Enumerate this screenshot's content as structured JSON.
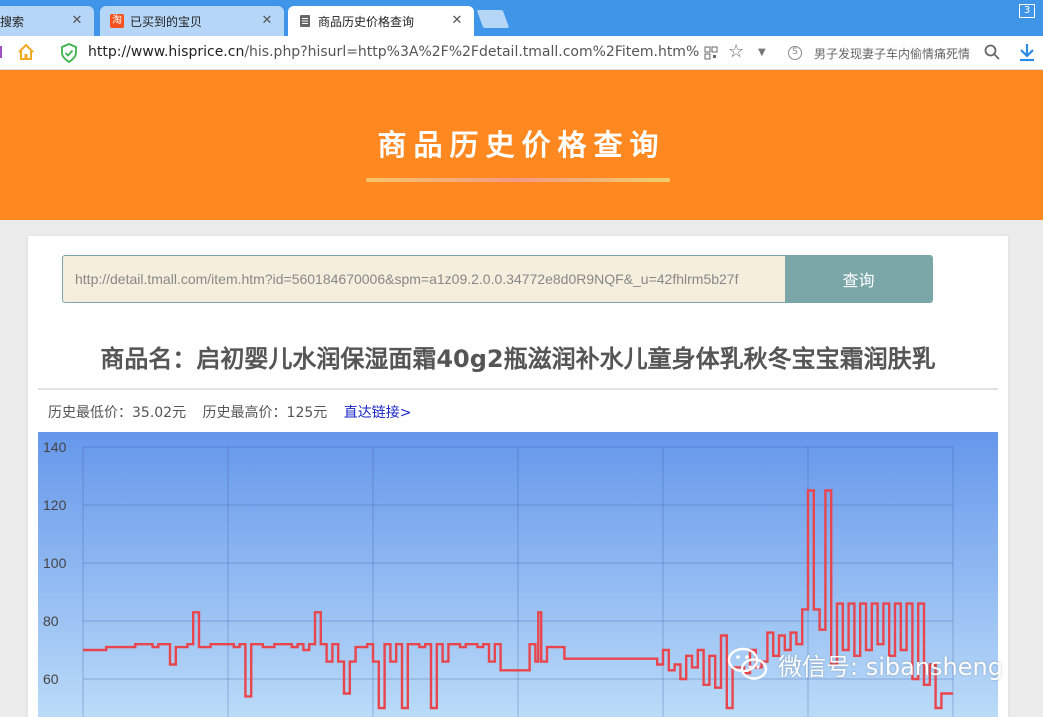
{
  "browser": {
    "tabs": [
      {
        "title": "搜索",
        "active": false
      },
      {
        "title": "已买到的宝贝",
        "active": false,
        "favicon": "淘"
      },
      {
        "title": "商品历史价格查询",
        "active": true
      }
    ],
    "tab_count": "3",
    "url_host": "http://www.hisprice.cn",
    "url_path": "/his.php?hisurl=http%3A%2F%2Fdetail.tmall.com%2Fitem.htm%3Fid%",
    "search_text": "男子发现妻子车内偷情痛死情"
  },
  "hero": {
    "title": "商品历史价格查询"
  },
  "query": {
    "input_value": "http://detail.tmall.com/item.htm?id=560184670006&spm=a1z09.2.0.0.34772e8d0R9NQF&_u=42fhlrm5b27f",
    "button_label": "查询"
  },
  "product": {
    "name": "商品名：启初婴儿水润保湿面霜40g2瓶滋润补水儿童身体乳秋冬宝宝霜润肤乳"
  },
  "price": {
    "lowest": "历史最低价：35.02元",
    "highest": "历史最高价：125元",
    "link": "直达链接>"
  },
  "watermark": "微信号: sibansheng",
  "colors": {
    "hero": "#ff8920",
    "button": "#7ba6a8",
    "line": "#e8454d",
    "chart_top": "#6597eb",
    "chart_bottom": "#bcdcf8"
  },
  "chart_data": {
    "type": "line",
    "yticks": [
      60,
      80,
      100,
      120,
      140
    ],
    "ylim": [
      50,
      140
    ],
    "xlim": [
      0,
      150
    ],
    "grid": true,
    "series": [
      {
        "values": [
          [
            0,
            70
          ],
          [
            4,
            70
          ],
          [
            4,
            71
          ],
          [
            7,
            71
          ],
          [
            9,
            71
          ],
          [
            9,
            72
          ],
          [
            12,
            72
          ],
          [
            12,
            71
          ],
          [
            13,
            71
          ],
          [
            13,
            72
          ],
          [
            15,
            72
          ],
          [
            15,
            65
          ],
          [
            16,
            65
          ],
          [
            16,
            71
          ],
          [
            18,
            71
          ],
          [
            18,
            72
          ],
          [
            19,
            72
          ],
          [
            19,
            83
          ],
          [
            20,
            83
          ],
          [
            20,
            71
          ],
          [
            22,
            71
          ],
          [
            22,
            72
          ],
          [
            26,
            72
          ],
          [
            26,
            71
          ],
          [
            27,
            71
          ],
          [
            27,
            72
          ],
          [
            28,
            72
          ],
          [
            28,
            54
          ],
          [
            29,
            54
          ],
          [
            29,
            72
          ],
          [
            31,
            72
          ],
          [
            31,
            71
          ],
          [
            33,
            71
          ],
          [
            33,
            72
          ],
          [
            36,
            72
          ],
          [
            36,
            71
          ],
          [
            37,
            71
          ],
          [
            37,
            72
          ],
          [
            38,
            72
          ],
          [
            38,
            70
          ],
          [
            39,
            70
          ],
          [
            39,
            72
          ],
          [
            40,
            72
          ],
          [
            40,
            83
          ],
          [
            41,
            83
          ],
          [
            41,
            72
          ],
          [
            42,
            72
          ],
          [
            42,
            66
          ],
          [
            43,
            66
          ],
          [
            43,
            72
          ],
          [
            44,
            72
          ],
          [
            44,
            66
          ],
          [
            45,
            66
          ],
          [
            45,
            55
          ],
          [
            46,
            55
          ],
          [
            46,
            66
          ],
          [
            47,
            66
          ],
          [
            47,
            71
          ],
          [
            49,
            71
          ],
          [
            49,
            72
          ],
          [
            50,
            72
          ],
          [
            50,
            66
          ],
          [
            51,
            66
          ],
          [
            51,
            50
          ],
          [
            52,
            50
          ],
          [
            52,
            72
          ],
          [
            53,
            72
          ],
          [
            53,
            66
          ],
          [
            54,
            66
          ],
          [
            54,
            72
          ],
          [
            55,
            72
          ],
          [
            55,
            50
          ],
          [
            56,
            50
          ],
          [
            56,
            72
          ],
          [
            58,
            72
          ],
          [
            58,
            71
          ],
          [
            59,
            71
          ],
          [
            59,
            72
          ],
          [
            60,
            72
          ],
          [
            60,
            50
          ],
          [
            61,
            50
          ],
          [
            61,
            72
          ],
          [
            62,
            72
          ],
          [
            62,
            66
          ],
          [
            63,
            66
          ],
          [
            63,
            72
          ],
          [
            65,
            72
          ],
          [
            65,
            71
          ],
          [
            66,
            71
          ],
          [
            66,
            72
          ],
          [
            68,
            72
          ],
          [
            68,
            71
          ],
          [
            69,
            71
          ],
          [
            69,
            72
          ],
          [
            70,
            72
          ],
          [
            70,
            66
          ],
          [
            71,
            66
          ],
          [
            71,
            72
          ],
          [
            72,
            72
          ],
          [
            72,
            63
          ],
          [
            77,
            63
          ],
          [
            77,
            72
          ],
          [
            78,
            72
          ],
          [
            78,
            66
          ],
          [
            78.5,
            66
          ],
          [
            78.5,
            83
          ],
          [
            79,
            83
          ],
          [
            79,
            66
          ],
          [
            80,
            66
          ],
          [
            80,
            71
          ],
          [
            83,
            71
          ],
          [
            83,
            67
          ],
          [
            99,
            67
          ],
          [
            99,
            65
          ],
          [
            100,
            65
          ],
          [
            100,
            70
          ],
          [
            101,
            70
          ],
          [
            101,
            63
          ],
          [
            102,
            63
          ],
          [
            102,
            65
          ],
          [
            103,
            65
          ],
          [
            103,
            60
          ],
          [
            104,
            60
          ],
          [
            104,
            68
          ],
          [
            105,
            68
          ],
          [
            105,
            64
          ],
          [
            106,
            64
          ],
          [
            106,
            70
          ],
          [
            107,
            70
          ],
          [
            107,
            58
          ],
          [
            108,
            58
          ],
          [
            108,
            68
          ],
          [
            109,
            68
          ],
          [
            109,
            57
          ],
          [
            110,
            57
          ],
          [
            110,
            75
          ],
          [
            111,
            75
          ],
          [
            111,
            50
          ],
          [
            112,
            50
          ],
          [
            112,
            64
          ],
          [
            114,
            64
          ],
          [
            114,
            62
          ],
          [
            115,
            62
          ],
          [
            115,
            70
          ],
          [
            116,
            70
          ],
          [
            116,
            64
          ],
          [
            117,
            64
          ],
          [
            117,
            66
          ],
          [
            118,
            66
          ],
          [
            118,
            76
          ],
          [
            119,
            76
          ],
          [
            119,
            68
          ],
          [
            120,
            68
          ],
          [
            120,
            75
          ],
          [
            121,
            75
          ],
          [
            121,
            70
          ],
          [
            122,
            70
          ],
          [
            122,
            76
          ],
          [
            123,
            76
          ],
          [
            123,
            72
          ],
          [
            124,
            72
          ],
          [
            124,
            84
          ],
          [
            125,
            84
          ],
          [
            125,
            125
          ],
          [
            126,
            125
          ],
          [
            126,
            84
          ],
          [
            127,
            84
          ],
          [
            127,
            77
          ],
          [
            128,
            77
          ],
          [
            128,
            125
          ],
          [
            129,
            125
          ],
          [
            129,
            65
          ],
          [
            130,
            65
          ],
          [
            130,
            86
          ],
          [
            131,
            86
          ],
          [
            131,
            70
          ],
          [
            132,
            70
          ],
          [
            132,
            86
          ],
          [
            133,
            86
          ],
          [
            133,
            68
          ],
          [
            134,
            68
          ],
          [
            134,
            86
          ],
          [
            135,
            86
          ],
          [
            135,
            70
          ],
          [
            136,
            70
          ],
          [
            136,
            86
          ],
          [
            137,
            86
          ],
          [
            137,
            72
          ],
          [
            138,
            72
          ],
          [
            138,
            86
          ],
          [
            139,
            86
          ],
          [
            139,
            68
          ],
          [
            140,
            68
          ],
          [
            140,
            86
          ],
          [
            141,
            86
          ],
          [
            141,
            70
          ],
          [
            142,
            70
          ],
          [
            142,
            86
          ],
          [
            143,
            86
          ],
          [
            143,
            60
          ],
          [
            144,
            60
          ],
          [
            144,
            86
          ],
          [
            145,
            86
          ],
          [
            145,
            58
          ],
          [
            146,
            58
          ],
          [
            146,
            65
          ],
          [
            147,
            65
          ],
          [
            147,
            50
          ],
          [
            148,
            50
          ],
          [
            148,
            55
          ],
          [
            150,
            55
          ]
        ]
      }
    ]
  }
}
